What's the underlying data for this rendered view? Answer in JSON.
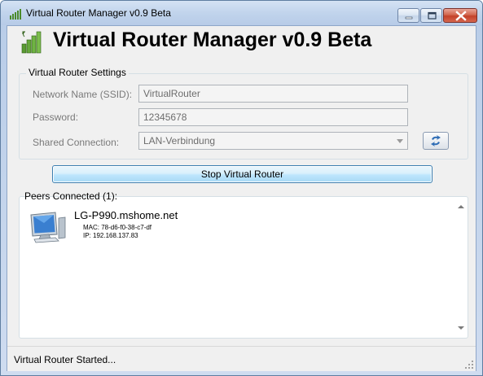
{
  "window": {
    "title": "Virtual Router Manager v0.9 Beta"
  },
  "header": {
    "app_title": "Virtual Router Manager v0.9 Beta",
    "logo_icon": "signal-bars-icon"
  },
  "settings": {
    "group_label": "Virtual Router Settings",
    "ssid_label": "Network Name (SSID):",
    "ssid_value": "VirtualRouter",
    "password_label": "Password:",
    "password_value": "12345678",
    "shared_label": "Shared Connection:",
    "shared_value": "LAN-Verbindung",
    "refresh_icon": "refresh-arrows-icon"
  },
  "actions": {
    "stop_label": "Stop Virtual Router"
  },
  "peers": {
    "label": "Peers Connected (1):",
    "items": [
      {
        "name": "LG-P990.mshome.net",
        "mac": "MAC: 78-d6-f0-38-c7-df",
        "ip": "IP: 192.168.137.83",
        "icon": "computer-monitor-icon"
      }
    ]
  },
  "status": {
    "text": "Virtual Router Started..."
  },
  "colors": {
    "accent_border": "#3c7fb1",
    "titlebar": "#c1d4ec",
    "close_button": "#c34129"
  }
}
